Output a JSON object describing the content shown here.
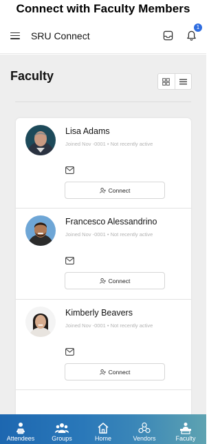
{
  "banner": {
    "title": "Connect with Faculty Members"
  },
  "appbar": {
    "title": "SRU Connect",
    "notification_count": "1"
  },
  "page": {
    "title": "Faculty"
  },
  "faculty": [
    {
      "name": "Lisa Adams",
      "joined": "Joined Nov -0001",
      "status": "Not recently active",
      "connect_label": "Connect"
    },
    {
      "name": "Francesco Alessandrino",
      "joined": "Joined Nov -0001",
      "status": "Not recently active",
      "connect_label": "Connect"
    },
    {
      "name": "Kimberly Beavers",
      "joined": "Joined Nov -0001",
      "status": "Not recently active",
      "connect_label": "Connect"
    }
  ],
  "tabs": [
    {
      "label": "Attendees",
      "icon": "attendee-icon"
    },
    {
      "label": "Groups",
      "icon": "groups-icon"
    },
    {
      "label": "Home",
      "icon": "home-icon"
    },
    {
      "label": "Vendors",
      "icon": "vendors-icon"
    },
    {
      "label": "Faculty",
      "icon": "faculty-icon"
    }
  ],
  "colors": {
    "accent": "#2f6de0",
    "tabbar_start": "#1d67b0",
    "tabbar_end": "#5ea3b1",
    "background": "#eeeeee"
  }
}
